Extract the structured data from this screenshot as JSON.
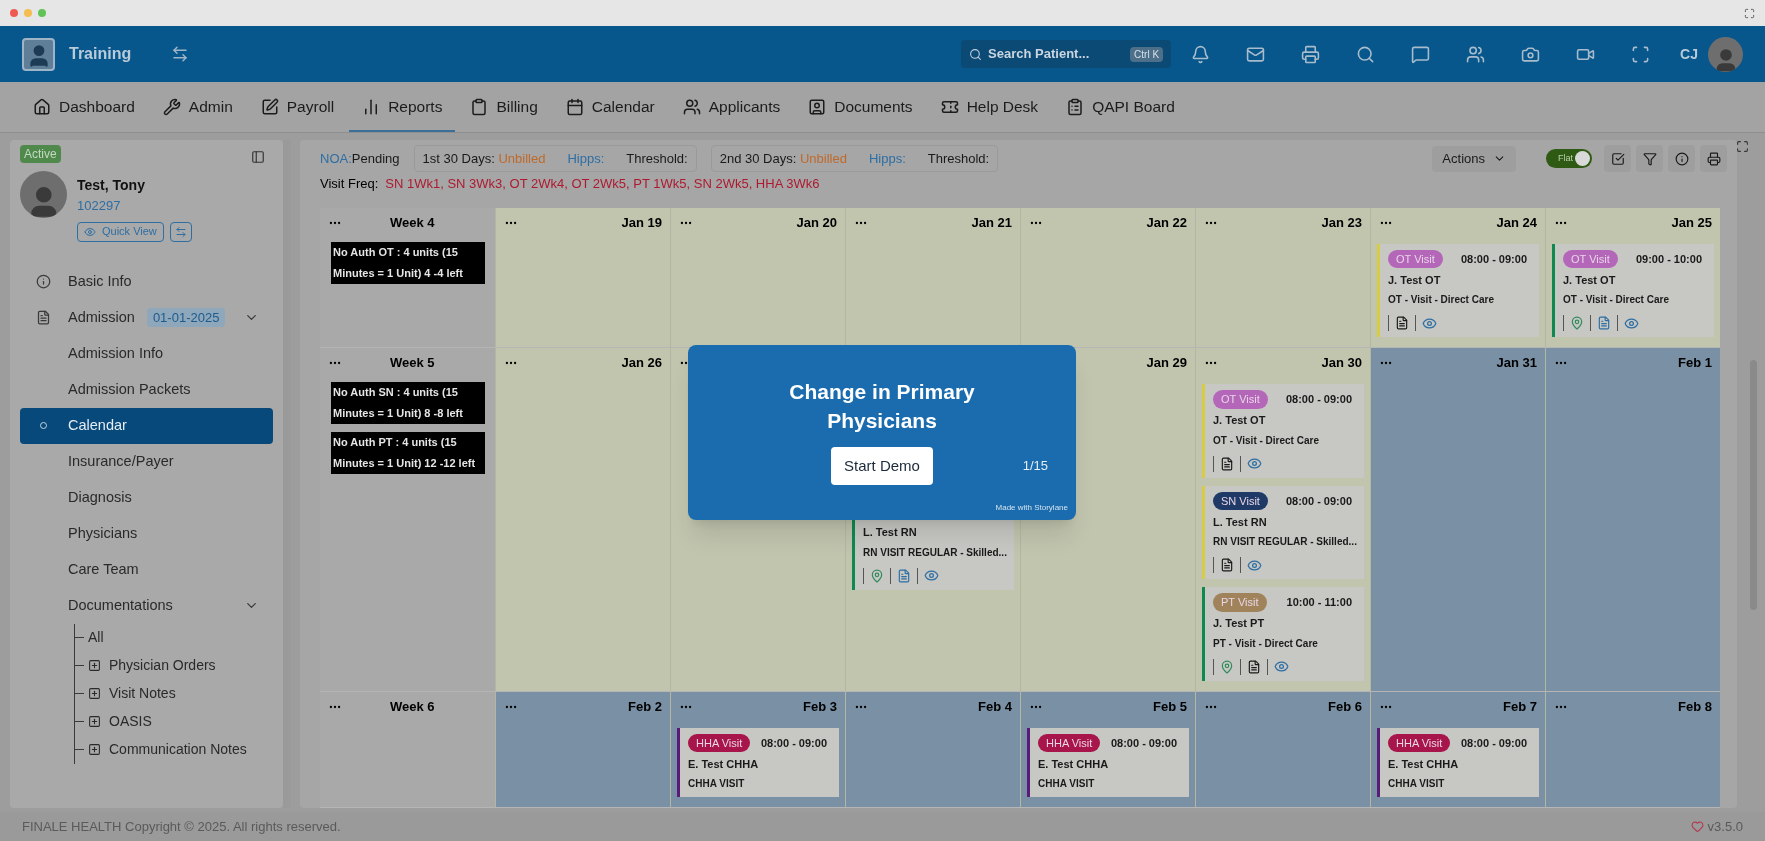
{
  "topbar": {
    "org": "Training",
    "search": {
      "placeholder": "Search Patient...",
      "shortcut": "Ctrl K"
    },
    "user_initials": "CJ"
  },
  "nav": [
    {
      "label": "Dashboard",
      "selected": false
    },
    {
      "label": "Admin",
      "selected": false
    },
    {
      "label": "Payroll",
      "selected": false
    },
    {
      "label": "Reports",
      "selected": true
    },
    {
      "label": "Billing",
      "selected": false
    },
    {
      "label": "Calendar",
      "selected": false
    },
    {
      "label": "Applicants",
      "selected": false
    },
    {
      "label": "Documents",
      "selected": false
    },
    {
      "label": "Help Desk",
      "selected": false
    },
    {
      "label": "QAPI Board",
      "selected": false
    }
  ],
  "sidebar": {
    "status": "Active",
    "patient_name": "Test, Tony",
    "patient_id": "102297",
    "quick_view": "Quick View",
    "items": [
      {
        "label": "Basic Info",
        "selected": false
      },
      {
        "label": "Admission",
        "badge": "01-01-2025",
        "expanded": true,
        "selected": false,
        "children": [
          {
            "label": "Admission Info",
            "selected": false
          },
          {
            "label": "Admission Packets",
            "selected": false
          },
          {
            "label": "Calendar",
            "selected": true
          },
          {
            "label": "Insurance/Payer",
            "selected": false
          },
          {
            "label": "Diagnosis",
            "selected": false
          },
          {
            "label": "Physicians",
            "selected": false
          },
          {
            "label": "Care Team",
            "selected": false
          },
          {
            "label": "Documentations",
            "expanded": true,
            "selected": false,
            "children": [
              {
                "label": "All",
                "expandable": false
              },
              {
                "label": "Physician Orders",
                "expandable": true
              },
              {
                "label": "Visit Notes",
                "expandable": true
              },
              {
                "label": "OASIS",
                "expandable": true
              },
              {
                "label": "Communication Notes",
                "expandable": true
              }
            ]
          }
        ]
      }
    ]
  },
  "summary": {
    "noa_label": "NOA:",
    "noa_value": "Pending",
    "periods": [
      {
        "label": "1st 30 Days:",
        "status": "Unbilled",
        "hipps": "Hipps:",
        "threshold": "Threshold:"
      },
      {
        "label": "2nd 30 Days:",
        "status": "Unbilled",
        "hipps": "Hipps:",
        "threshold": "Threshold:"
      }
    ],
    "visit_freq_label": "Visit Freq:",
    "visit_freq": "SN 1Wk1, SN 3Wk3, OT 2Wk4, OT 2Wk5, PT 1Wk5, SN 2Wk5, HHA 3Wk6"
  },
  "toolbar": {
    "actions": "Actions",
    "toggle": {
      "label": "Flat",
      "on": true
    }
  },
  "weeks": [
    {
      "label": "Week 4",
      "notes": [
        "No Auth OT : 4 units (15 Minutes = 1 Unit) 4 -4 left"
      ],
      "days": [
        {
          "date": "Jan 19",
          "past": true
        },
        {
          "date": "Jan 20",
          "past": true
        },
        {
          "date": "Jan 21",
          "past": true
        },
        {
          "date": "Jan 22",
          "past": true
        },
        {
          "date": "Jan 23",
          "past": true
        },
        {
          "date": "Jan 24",
          "past": true,
          "visits": [
            {
              "kind": "ot",
              "type": "OT Visit",
              "time": "08:00 - 09:00",
              "clinician": "J. Test OT",
              "service": "OT - Visit - Direct Care",
              "color": "#d9cc45",
              "location": false,
              "note_signed": false
            }
          ]
        },
        {
          "date": "Jan 25",
          "past": true,
          "visits": [
            {
              "kind": "ot",
              "type": "OT Visit",
              "time": "09:00 - 10:00",
              "clinician": "J. Test OT",
              "service": "OT - Visit - Direct Care",
              "color": "#0e8a50",
              "location": true,
              "note_signed": true
            }
          ]
        }
      ]
    },
    {
      "label": "Week 5",
      "notes": [
        "No Auth SN : 4 units (15 Minutes = 1 Unit) 8 -8 left",
        "No Auth PT : 4 units (15 Minutes = 1 Unit) 12 -12 left"
      ],
      "days": [
        {
          "date": "Jan 26",
          "past": true
        },
        {
          "past": true
        },
        {
          "past": true,
          "visits": [
            {
              "clinician": "L. Test RN",
              "service": "RN VISIT REGULAR - Skilled...",
              "color": "#0e8a50",
              "location": true,
              "note_signed": true
            }
          ]
        },
        {
          "date": "Jan 29",
          "past": true
        },
        {
          "date": "Jan 30",
          "past": true,
          "visits": [
            {
              "kind": "ot",
              "type": "OT Visit",
              "time": "08:00 - 09:00",
              "clinician": "J. Test OT",
              "service": "OT - Visit - Direct Care",
              "color": "#d9cc45",
              "location": false,
              "note_signed": false
            },
            {
              "kind": "sn",
              "type": "SN Visit",
              "time": "08:00 - 09:00",
              "clinician": "L. Test RN",
              "service": "RN VISIT REGULAR - Skilled...",
              "color": "#d9cc45",
              "location": false,
              "note_signed": false
            },
            {
              "kind": "pt",
              "type": "PT Visit",
              "time": "10:00 - 11:00",
              "clinician": "J. Test PT",
              "service": "PT - Visit - Direct Care",
              "color": "#0e8a50",
              "location": true,
              "note_signed": false
            }
          ]
        },
        {
          "date": "Jan 31",
          "past": false
        },
        {
          "date": "Feb 1",
          "past": false
        }
      ]
    },
    {
      "label": "Week 6",
      "days": [
        {
          "date": "Feb 2",
          "past": false
        },
        {
          "date": "Feb 3",
          "past": false,
          "visits": [
            {
              "kind": "hha",
              "type": "HHA Visit",
              "time": "08:00 - 09:00",
              "clinician": "E. Test CHHA",
              "service": "CHHA VISIT",
              "color": "#5a1a7a"
            }
          ]
        },
        {
          "date": "Feb 4",
          "past": false
        },
        {
          "date": "Feb 5",
          "past": false,
          "visits": [
            {
              "kind": "hha",
              "type": "HHA Visit",
              "time": "08:00 - 09:00",
              "clinician": "E. Test CHHA",
              "service": "CHHA VISIT",
              "color": "#5a1a7a"
            }
          ]
        },
        {
          "date": "Feb 6",
          "past": false
        },
        {
          "date": "Feb 7",
          "past": false,
          "visits": [
            {
              "kind": "hha",
              "type": "HHA Visit",
              "time": "08:00 - 09:00",
              "clinician": "E. Test CHHA",
              "service": "CHHA VISIT",
              "color": "#5a1a7a"
            }
          ]
        },
        {
          "date": "Feb 8",
          "past": false
        }
      ]
    }
  ],
  "demo_popup": {
    "title": "Change in Primary Physicians",
    "button": "Start Demo",
    "step": "1/15",
    "credit": "Made with Storylane"
  },
  "footer": {
    "copyright": "FINALE HEALTH Copyright © 2025. All rights reserved.",
    "version": "v3.5.0"
  }
}
